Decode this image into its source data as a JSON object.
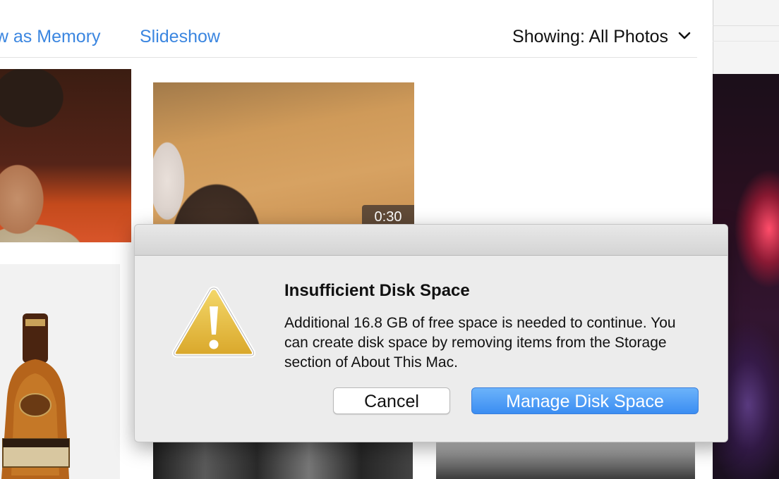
{
  "toolbar": {
    "memory_label": "ow as Memory",
    "slideshow_label": "Slideshow",
    "showing_prefix": "Showing:",
    "showing_value": "All Photos",
    "showing_icon": "chevron-down-icon"
  },
  "photos": {
    "video_duration": "0:30"
  },
  "alert": {
    "title": "Insufficient Disk Space",
    "message": "Additional 16.8 GB of free space is needed to continue. You can create disk space by removing items from the Storage section of About This Mac.",
    "icon": "warning-icon",
    "cancel_label": "Cancel",
    "manage_label": "Manage Disk Space"
  },
  "colors": {
    "link_blue": "#3b86e0",
    "primary_button": "#3b8df2",
    "warning_yellow": "#e6b83a"
  }
}
